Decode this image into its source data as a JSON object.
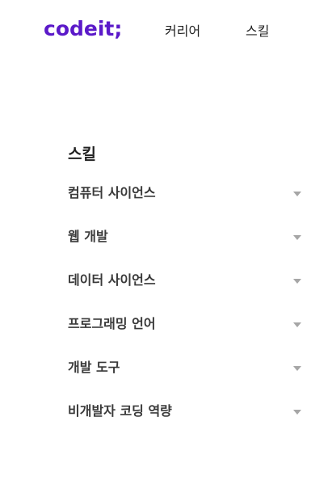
{
  "header": {
    "logo": "codeit;",
    "nav": [
      {
        "label": "커리어"
      },
      {
        "label": "스킬"
      }
    ]
  },
  "skills": {
    "title": "스킬",
    "items": [
      {
        "label": "컴퓨터 사이언스",
        "icon": "caret-down-icon"
      },
      {
        "label": "웹 개발",
        "icon": "caret-down-icon"
      },
      {
        "label": "데이터 사이언스",
        "icon": "caret-down-icon"
      },
      {
        "label": "프로그래밍 언어",
        "icon": "caret-down-icon"
      },
      {
        "label": "개발 도구",
        "icon": "caret-down-icon"
      },
      {
        "label": "비개발자 코딩 역량",
        "icon": "caret-down-icon"
      }
    ]
  },
  "colors": {
    "brand": "#5b19c9",
    "text": "#333333",
    "caret": "#a6a6a6",
    "background": "#ffffff"
  }
}
